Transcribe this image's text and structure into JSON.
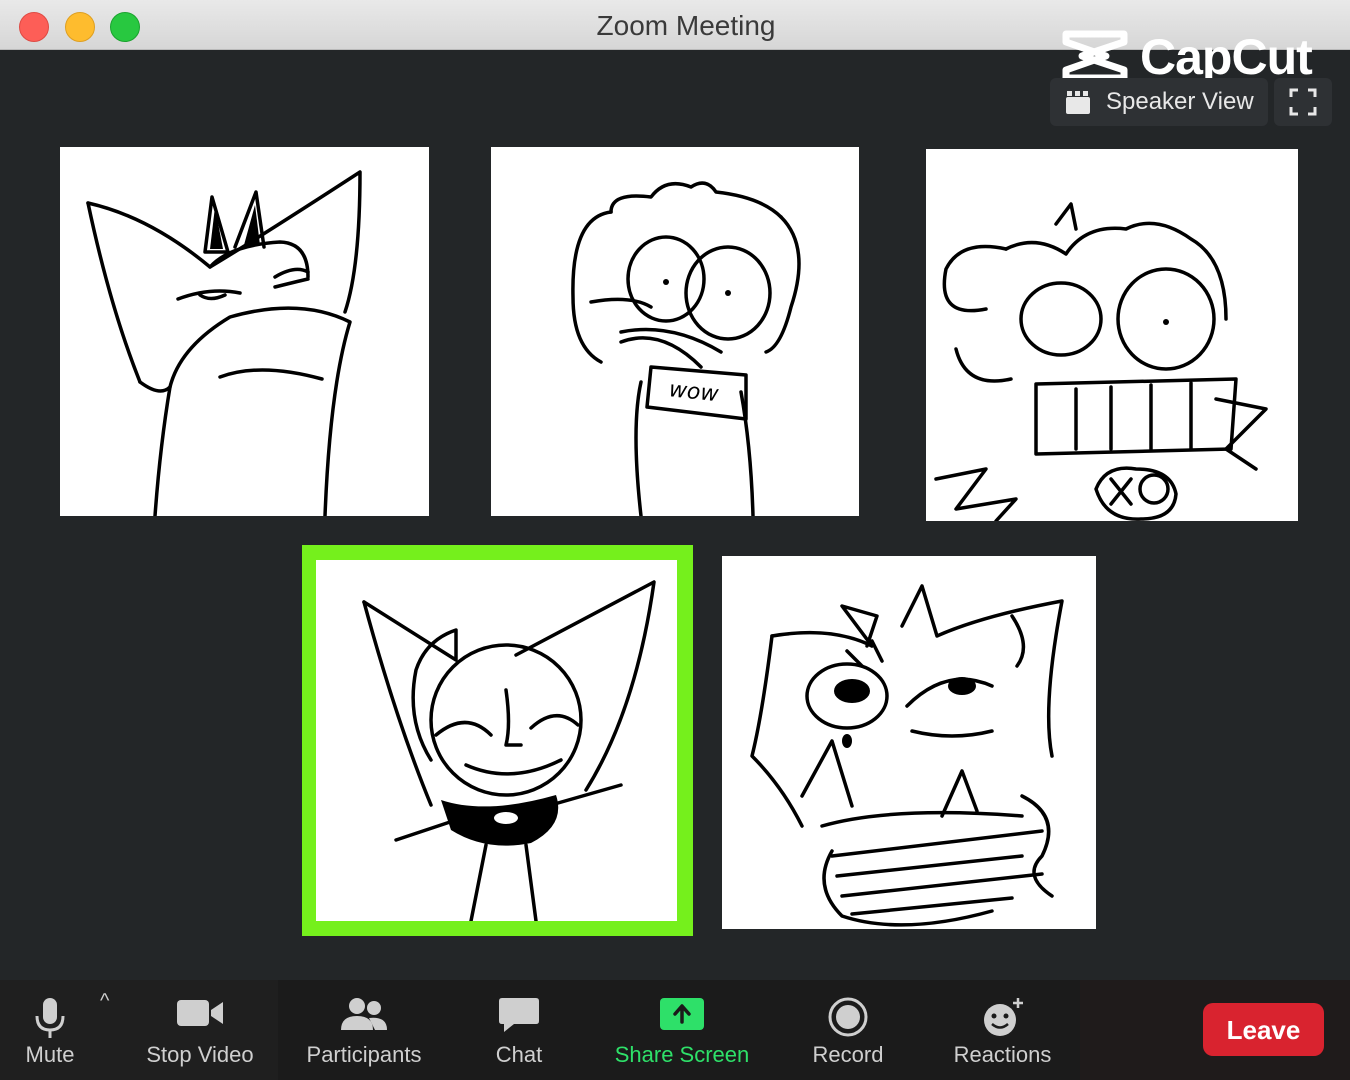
{
  "window": {
    "title": "Zoom Meeting"
  },
  "watermark": {
    "brand": "CapCut"
  },
  "view": {
    "speaker_view_label": "Speaker View"
  },
  "toolbar": {
    "mute_label": "Mute",
    "stop_video_label": "Stop Video",
    "participants_label": "Participants",
    "chat_label": "Chat",
    "share_screen_label": "Share Screen",
    "record_label": "Record",
    "reactions_label": "Reactions",
    "leave_label": "Leave"
  },
  "tiles": [
    {
      "id": "participant-1",
      "active": false
    },
    {
      "id": "participant-2",
      "active": false,
      "sign_text": "wow"
    },
    {
      "id": "participant-3",
      "active": false
    },
    {
      "id": "participant-4",
      "active": true
    },
    {
      "id": "participant-5",
      "active": false
    }
  ],
  "colors": {
    "background": "#232628",
    "active_speaker": "#75f01c",
    "share_screen": "#2ee069",
    "leave": "#d9232f"
  }
}
